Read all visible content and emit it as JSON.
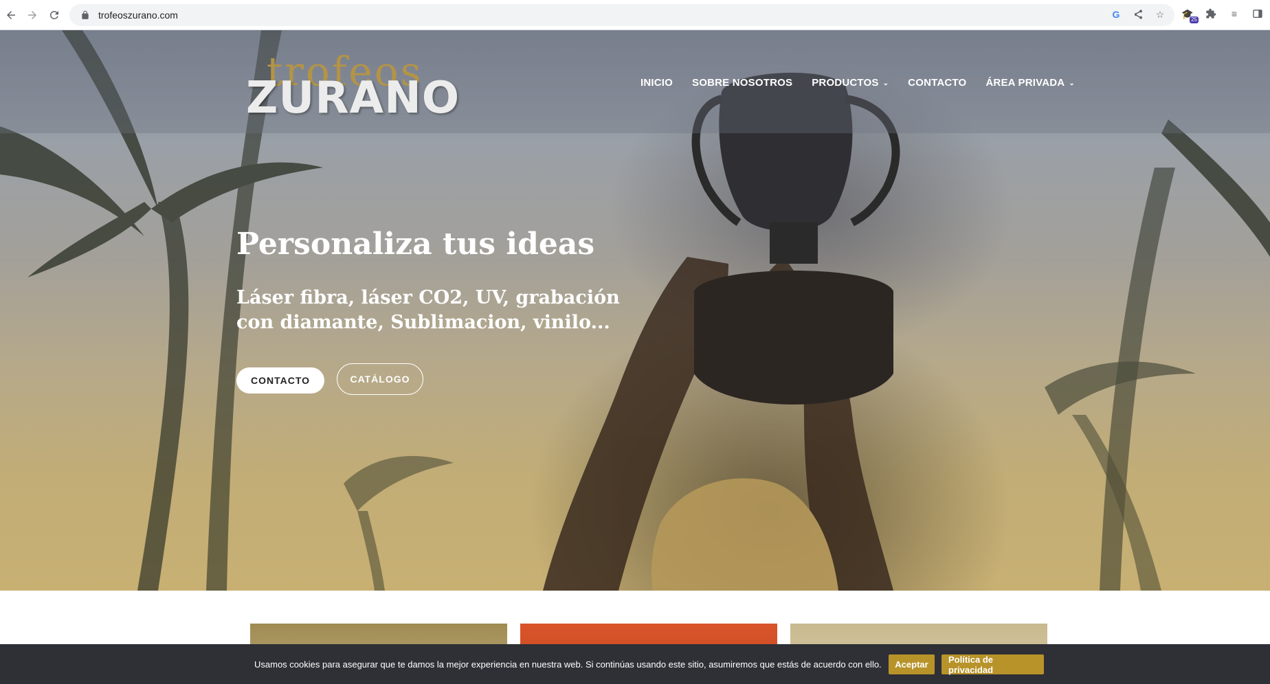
{
  "browser": {
    "url": "trofeoszurano.com",
    "extension_badge": "25"
  },
  "site": {
    "logo_script": "trofeos",
    "logo_main": "ZURANO",
    "menu": [
      {
        "label": "INICIO",
        "dropdown": false
      },
      {
        "label": "SOBRE NOSOTROS",
        "dropdown": false
      },
      {
        "label": "PRODUCTOS",
        "dropdown": true
      },
      {
        "label": "CONTACTO",
        "dropdown": false
      },
      {
        "label": "ÁREA PRIVADA",
        "dropdown": true
      }
    ]
  },
  "hero": {
    "title": "Personaliza tus ideas",
    "subtitle": "Láser fibra, láser CO2, UV, grabación con diamante, Sublimacion, vinilo...",
    "btn_contact": "CONTACTO",
    "btn_catalog": "CATÁLOGO"
  },
  "cookie": {
    "text": "Usamos cookies para asegurar que te damos la mejor experiencia en nuestra web. Si continúas usando este sitio, asumiremos que estás de acuerdo con ello.",
    "accept": "Aceptar",
    "privacy": "Política de privacidad"
  },
  "colors": {
    "accent_gold": "#b8932a",
    "cookie_bg": "#2e3036"
  }
}
